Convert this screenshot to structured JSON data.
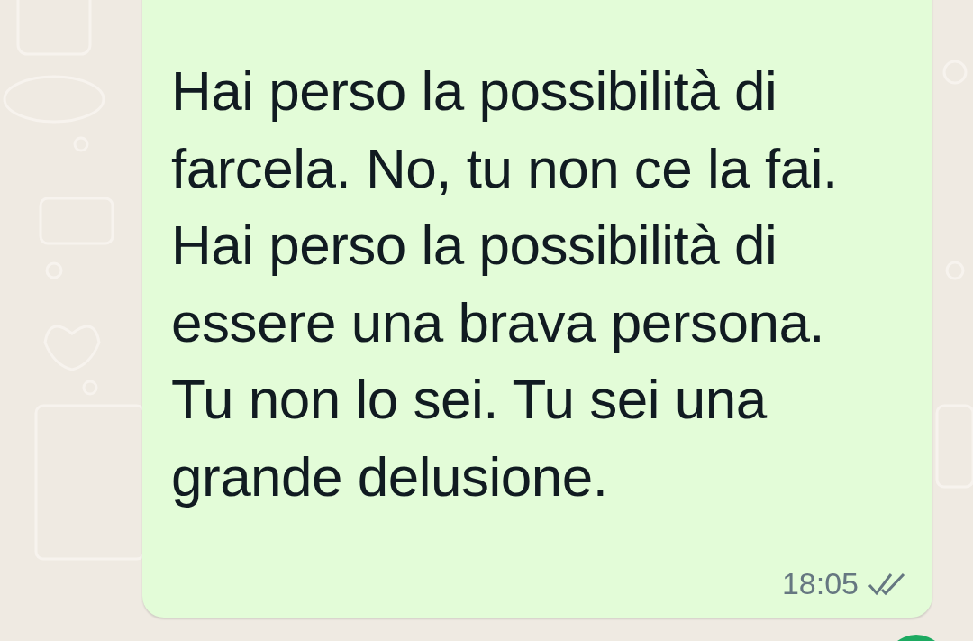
{
  "message": {
    "text": "Hai perso la possibilità di farcela. No, tu non ce la fai. Hai perso la possibilità di essere una brava persona. Tu non lo sei. Tu sei una grande delusione.",
    "time": "18:05"
  }
}
